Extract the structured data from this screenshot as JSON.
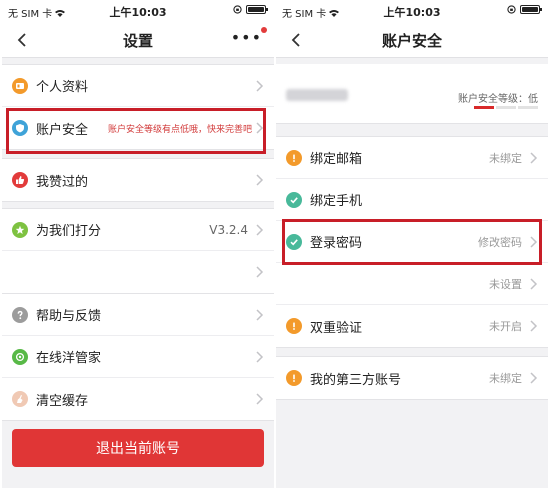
{
  "left": {
    "status": {
      "carrier": "无 SIM 卡",
      "time": "上午10:03"
    },
    "title": "设置",
    "items": [
      {
        "label": "个人资料",
        "value": ""
      },
      {
        "label": "账户安全",
        "value": "账户安全等级有点低哦，快来完善吧"
      },
      {
        "label": "我赞过的",
        "value": ""
      },
      {
        "label": "为我们打分",
        "value": "V3.2.4"
      },
      {
        "label": "",
        "value": ""
      },
      {
        "label": "帮助与反馈",
        "value": ""
      },
      {
        "label": "在线洋管家",
        "value": ""
      },
      {
        "label": "清空缓存",
        "value": ""
      }
    ],
    "logout": "退出当前账号",
    "colors": {
      "accent": "#e03636",
      "highlight": "#c81e28"
    }
  },
  "right": {
    "status": {
      "carrier": "无 SIM 卡",
      "time": "上午10:03"
    },
    "title": "账户安全",
    "account": {
      "level_label": "账户安全等级：低",
      "level_fraction": 0.33
    },
    "items": [
      {
        "label": "绑定邮箱",
        "value": "未绑定",
        "status": "warning"
      },
      {
        "label": "绑定手机",
        "value": "",
        "status": "ok"
      },
      {
        "label": "登录密码",
        "value": "修改密码",
        "status": "ok"
      },
      {
        "label": "",
        "value": "未设置",
        "status": "none"
      },
      {
        "label": "双重验证",
        "value": "未开启",
        "status": "warning"
      },
      {
        "label": "我的第三方账号",
        "value": "未绑定",
        "status": "warning"
      }
    ]
  }
}
